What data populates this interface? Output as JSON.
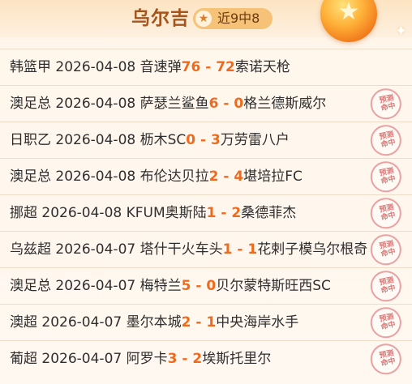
{
  "header": {
    "team_name": "乌尔吉",
    "badge_icon": "star-icon",
    "badge_text": "近9中8",
    "badge_color": "#f5c277",
    "title_color": "#a5541c"
  },
  "stamp_text": [
    "预测",
    "命中"
  ],
  "accent_color": "#ef6a1c",
  "matches": [
    {
      "league": "韩篮甲",
      "date": "2026-04-08",
      "home": "音速弹",
      "home_score": "76",
      "sep": " - ",
      "away_score": "72",
      "away": "索诺天枪",
      "hit_stamp": false
    },
    {
      "league": "澳足总",
      "date": "2026-04-08",
      "home": "萨瑟兰鲨鱼",
      "home_score": "6",
      "sep": " - ",
      "away_score": "0",
      "away": "格兰德斯威尔",
      "hit_stamp": true
    },
    {
      "league": "日职乙",
      "date": "2026-04-08",
      "home": "枥木SC",
      "home_score": "0",
      "sep": " - ",
      "away_score": "3",
      "away": "万劳雷八户",
      "hit_stamp": true
    },
    {
      "league": "澳足总",
      "date": "2026-04-08",
      "home": "布伦达贝拉",
      "home_score": "2",
      "sep": " - ",
      "away_score": "4",
      "away": "堪培拉FC",
      "hit_stamp": true
    },
    {
      "league": "挪超",
      "date": "2026-04-08",
      "home": "KFUM奥斯陆",
      "home_score": "1",
      "sep": " - ",
      "away_score": "2",
      "away": "桑德菲杰",
      "hit_stamp": true
    },
    {
      "league": "乌兹超",
      "date": "2026-04-07",
      "home": "塔什干火车头",
      "home_score": "1",
      "sep": " - ",
      "away_score": "1",
      "away": "花剌子模乌尔根奇",
      "hit_stamp": true
    },
    {
      "league": "澳足总",
      "date": "2026-04-07",
      "home": "梅特兰",
      "home_score": "5",
      "sep": " - ",
      "away_score": "0",
      "away": "贝尔蒙特斯旺西SC",
      "hit_stamp": true
    },
    {
      "league": "澳超",
      "date": "2026-04-07",
      "home": "墨尔本城",
      "home_score": "2",
      "sep": " - ",
      "away_score": "1",
      "away": "中央海岸水手",
      "hit_stamp": true
    },
    {
      "league": "葡超",
      "date": "2026-04-07",
      "home": "阿罗卡",
      "home_score": "3",
      "sep": " - ",
      "away_score": "2",
      "away": "埃斯托里尔",
      "hit_stamp": true
    }
  ]
}
